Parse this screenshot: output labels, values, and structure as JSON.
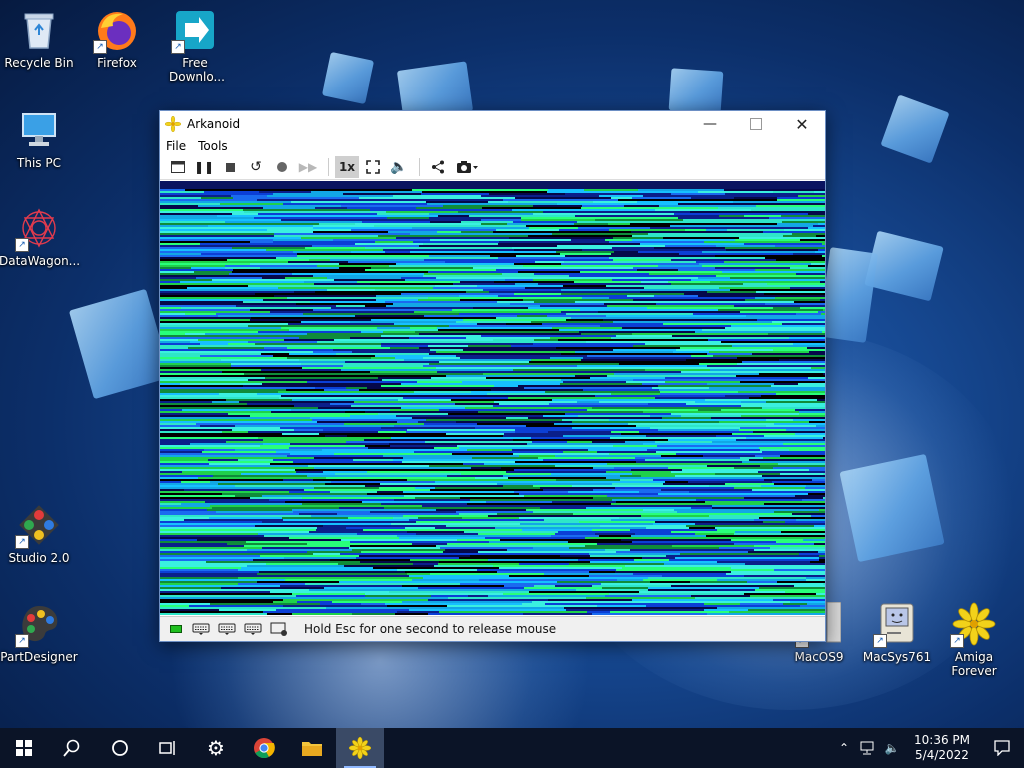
{
  "desktop": {
    "icons_left": [
      {
        "label": "Recycle Bin",
        "icon": "recycle-bin-icon"
      },
      {
        "label": "Firefox",
        "icon": "firefox-icon"
      },
      {
        "label": "Free Downlo...",
        "icon": "free-download-icon"
      },
      {
        "label": "This PC",
        "icon": "this-pc-icon"
      },
      {
        "label": "DataWagon...",
        "icon": "datawagon-icon"
      },
      {
        "label": "Studio 2.0",
        "icon": "studio-icon"
      },
      {
        "label": "PartDesigner",
        "icon": "partdesigner-icon"
      }
    ],
    "icons_right": [
      {
        "label": "MacOS9",
        "icon": "macos9-icon"
      },
      {
        "label": "MacSys761",
        "icon": "macsys761-icon"
      },
      {
        "label": "Amiga Forever",
        "icon": "amiga-forever-icon"
      }
    ]
  },
  "window": {
    "title": "Arkanoid",
    "menu": [
      "File",
      "Tools"
    ],
    "toolbar": {
      "speed_label": "1x"
    },
    "status": {
      "message": "Hold Esc for one second to release mouse"
    }
  },
  "taskbar": {
    "time": "10:36 PM",
    "date": "5/4/2022"
  },
  "colors": {
    "led": "#1fbf1f",
    "taskbar": "#0b1427",
    "accent": "#8fb8ff"
  }
}
